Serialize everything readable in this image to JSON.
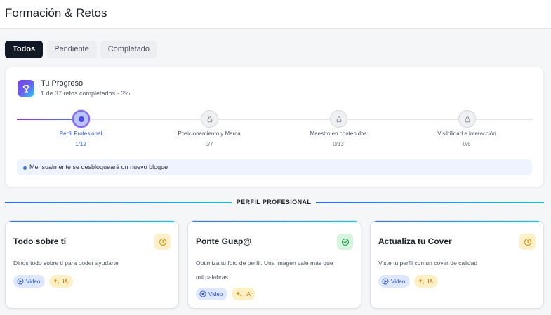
{
  "header": {
    "title": "Formación & Retos"
  },
  "tabs": [
    {
      "label": "Todos",
      "active": true
    },
    {
      "label": "Pendiente",
      "active": false
    },
    {
      "label": "Completado",
      "active": false
    }
  ],
  "progress": {
    "title": "Tu Progreso",
    "subtitle": "1 de 37 retos completados · 3%",
    "stages": [
      {
        "label": "Perfil Profesional",
        "count": "1/12",
        "state": "active"
      },
      {
        "label": "Posicionamiento y Marca",
        "count": "0/7",
        "state": "locked"
      },
      {
        "label": "Maestro en contenidos",
        "count": "0/13",
        "state": "locked"
      },
      {
        "label": "Visibilidad e interacción",
        "count": "0/5",
        "state": "locked"
      }
    ],
    "notice": "Mensualmente se desbloqueará un nuevo bloque"
  },
  "section": {
    "title": "PERFIL PROFESIONAL"
  },
  "cards": [
    {
      "title": "Todo sobre ti",
      "description": "Dinos todo sobre ti para poder ayudarte",
      "status": "pending",
      "badges": {
        "video": "Video",
        "ai": "IA"
      }
    },
    {
      "title": "Ponte Guap@",
      "description": "Optimiza tu foto de perfil. Una imagen vale más que mil palabras",
      "status": "completed",
      "badges": {
        "video": "Video",
        "ai": "IA"
      }
    },
    {
      "title": "Actualiza tu Cover",
      "description": "Viste tu perfil con un cover de calidad",
      "status": "pending",
      "badges": {
        "video": "Video",
        "ai": "IA"
      }
    }
  ],
  "colors": {
    "accent": "#3b6ff0",
    "tab_active_bg": "#121826",
    "pending": "#d99a1a",
    "completed": "#22a046"
  }
}
